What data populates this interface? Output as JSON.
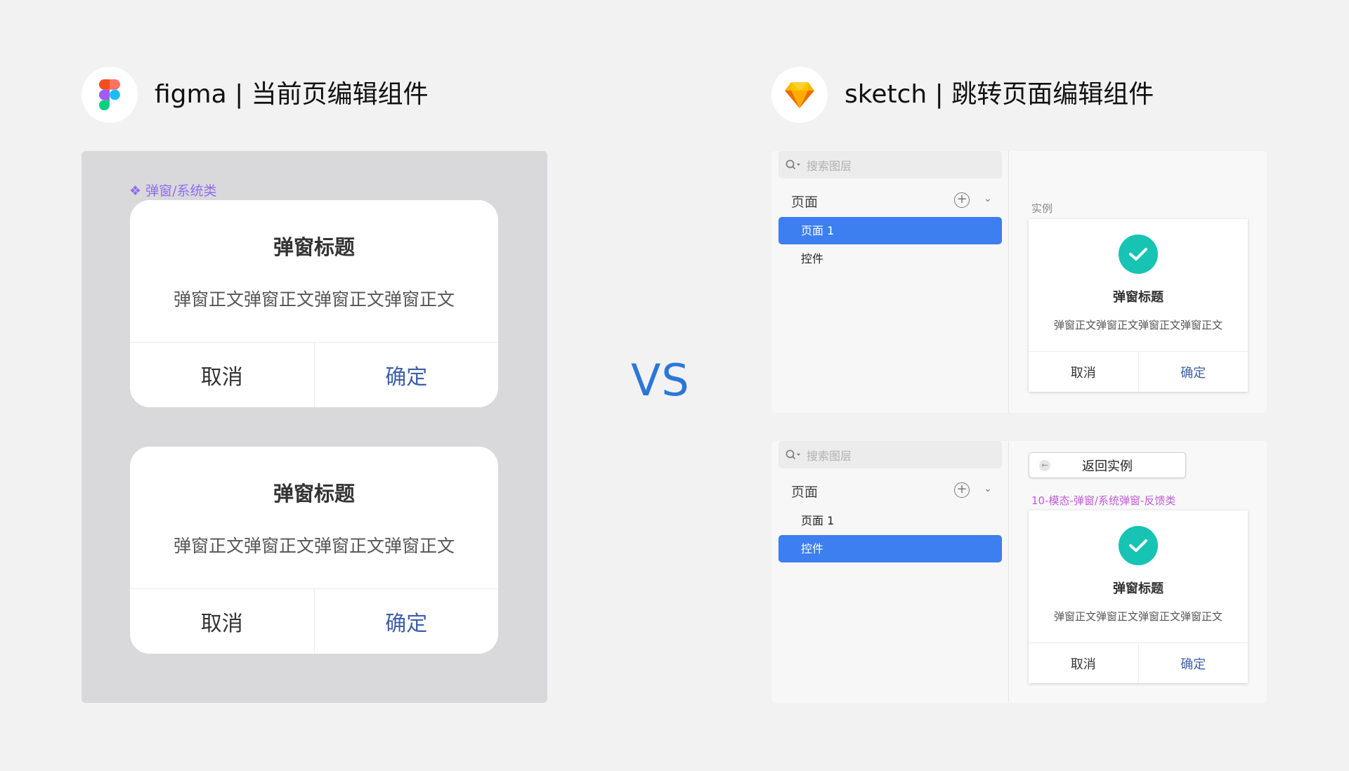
{
  "figma": {
    "title": "figma | 当前页编辑组件",
    "component_label": "❖ 弹窗/系统类",
    "dialogs": [
      {
        "title": "弹窗标题",
        "body": "弹窗正文弹窗正文弹窗正文弹窗正文",
        "cancel": "取消",
        "ok": "确定"
      },
      {
        "title": "弹窗标题",
        "body": "弹窗正文弹窗正文弹窗正文弹窗正文",
        "cancel": "取消",
        "ok": "确定"
      }
    ]
  },
  "vs_label": "VS",
  "sketch": {
    "title": "sketch | 跳转页面编辑组件",
    "panels": [
      {
        "search_placeholder": "搜索图层",
        "pages_title": "页面",
        "pages": [
          "页面 1",
          "控件"
        ],
        "selected_page": "页面 1",
        "canvas_label": "实例",
        "dialog": {
          "title": "弹窗标题",
          "body": "弹窗正文弹窗正文弹窗正文弹窗正文",
          "cancel": "取消",
          "ok": "确定"
        }
      },
      {
        "search_placeholder": "搜索图层",
        "pages_title": "页面",
        "pages": [
          "页面 1",
          "控件"
        ],
        "selected_page": "控件",
        "back_button": "返回实例",
        "symbol_label": "10-模态-弹窗/系统弹窗-反馈类",
        "dialog": {
          "title": "弹窗标题",
          "body": "弹窗正文弹窗正文弹窗正文弹窗正文",
          "cancel": "取消",
          "ok": "确定"
        }
      }
    ]
  },
  "colors": {
    "accent_blue": "#3d7ef0",
    "vs_blue": "#2b77d8",
    "figma_component_purple": "#8f6cf2",
    "sketch_symbol_purple": "#c25bd9",
    "check_teal": "#17c3b2",
    "confirm_blue": "#3d5fa8"
  }
}
